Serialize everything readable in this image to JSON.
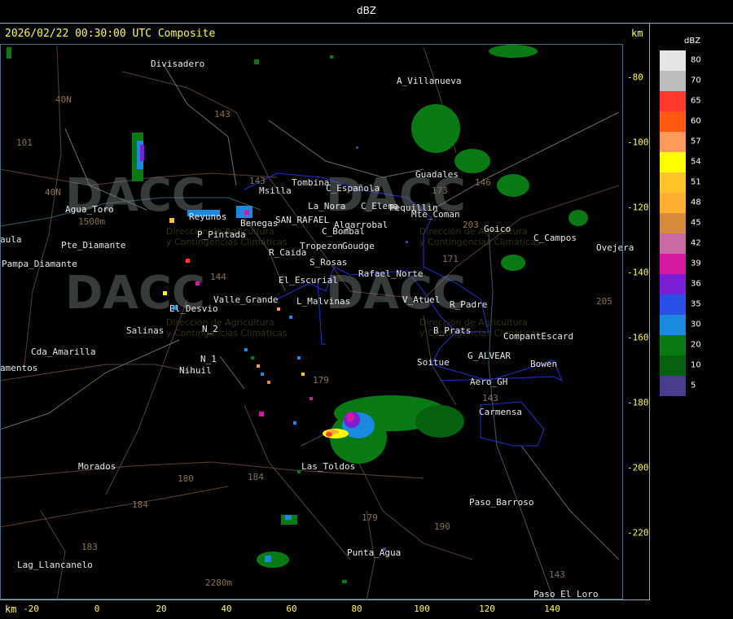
{
  "header": {
    "title": "dBZ"
  },
  "stamp": "2026/02/22 00:30:00 UTC Composite",
  "units": {
    "top": "km",
    "bottom": "km"
  },
  "x_ticks": [
    "-20",
    "0",
    "20",
    "40",
    "60",
    "80",
    "100",
    "120",
    "140"
  ],
  "y_ticks": [
    "-80",
    "-100",
    "-120",
    "-140",
    "-160",
    "-180",
    "-200",
    "-220"
  ],
  "legend": {
    "title": "dBZ",
    "items": [
      {
        "label": "80",
        "color": "#e6e6e6"
      },
      {
        "label": "70",
        "color": "#bdbdbd"
      },
      {
        "label": "65",
        "color": "#ff3a2a"
      },
      {
        "label": "60",
        "color": "#ff5a10"
      },
      {
        "label": "57",
        "color": "#ff9a5a"
      },
      {
        "label": "54",
        "color": "#ffff00"
      },
      {
        "label": "51",
        "color": "#ffc428"
      },
      {
        "label": "48",
        "color": "#ffb030"
      },
      {
        "label": "45",
        "color": "#d98a3a"
      },
      {
        "label": "42",
        "color": "#c96aa0"
      },
      {
        "label": "39",
        "color": "#d418a0"
      },
      {
        "label": "36",
        "color": "#7a1fd6"
      },
      {
        "label": "35",
        "color": "#2a4fe6"
      },
      {
        "label": "30",
        "color": "#1a8ae0"
      },
      {
        "label": "20",
        "color": "#0a7a14"
      },
      {
        "label": "10",
        "color": "#056010"
      },
      {
        "label": "5",
        "color": "#4a3c8c"
      }
    ]
  },
  "places": [
    "Divisadero",
    "A_Villanueva",
    "Guadales",
    "Tombina",
    "Msilla",
    "C_Española",
    "La_Nora",
    "C_Elena",
    "Pequillin",
    "Mte_Coman",
    "Agua_Toro",
    "Reyunos",
    "Benegas",
    "SAN_RAFAEL",
    "Algarrobal",
    "Goico",
    "C_Campos",
    "Ovejera",
    "aula",
    "Pampa_Diamante",
    "Pte_Diamante",
    "P_Pintada",
    "C_Bombal",
    "Tropezon",
    "Goudge",
    "R_Caida",
    "S_Rosas",
    "Rafael_Norte",
    "El_Escurial",
    "Valle_Grande",
    "L_Malvinas",
    "V_Atuel",
    "R_Padre",
    "El_Desvio",
    "Salinas",
    "N_2",
    "N_1",
    "Nihuil",
    "B_Prats",
    "CompantEscard",
    "G_ALVEAR",
    "Bowen",
    "Cda_Amarilla",
    "amentos",
    "Soitue",
    "Aero_GH",
    "Carmensa",
    "Morados",
    "Las_Toldos",
    "Paso_Barroso",
    "Punta_Agua",
    "Lag_Llancanelo",
    "Paso_El_Loro"
  ],
  "routes": [
    "40N",
    "101",
    "143",
    "40N",
    "143",
    "144",
    "179",
    "180",
    "184",
    "184",
    "190",
    "171",
    "146",
    "143",
    "143",
    "183",
    "179",
    "173",
    "203",
    "205",
    "2280m",
    "1500m"
  ],
  "watermark": {
    "brand": "DACC",
    "line1": "Dirección de Agricultura",
    "line2": "y Contingencias Climáticas"
  }
}
